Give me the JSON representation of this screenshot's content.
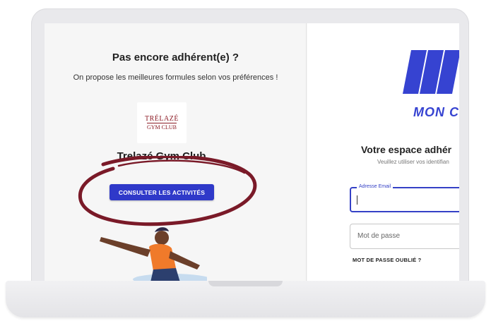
{
  "left_panel": {
    "title": "Pas encore adhérent(e) ?",
    "subtitle": "On propose les meilleures formules selon vos préférences !",
    "club_logo_line1": "TRÉLAZÉ",
    "club_logo_line2": "GYM CLUB",
    "club_name": "Trelazé Gym Club",
    "activities_button": "CONSULTER LES ACTIVITÉS"
  },
  "right_panel": {
    "brand_name": "MON C",
    "space_title": "Votre espace adhér",
    "space_subtitle": "Veuillez utiliser vos identifian",
    "email_label": "Adresse Email",
    "password_placeholder": "Mot de passe",
    "forgot_password": "MOT DE PASSE OUBLIÉ ?"
  },
  "colors": {
    "accent": "#2f39c9",
    "brand": "#3643d1",
    "highlight_ellipse": "#7a1a28",
    "club_logo": "#8b1a24"
  },
  "icons": {
    "brand_logo": "brand-logo-icon",
    "person": "person-illustration-icon"
  }
}
